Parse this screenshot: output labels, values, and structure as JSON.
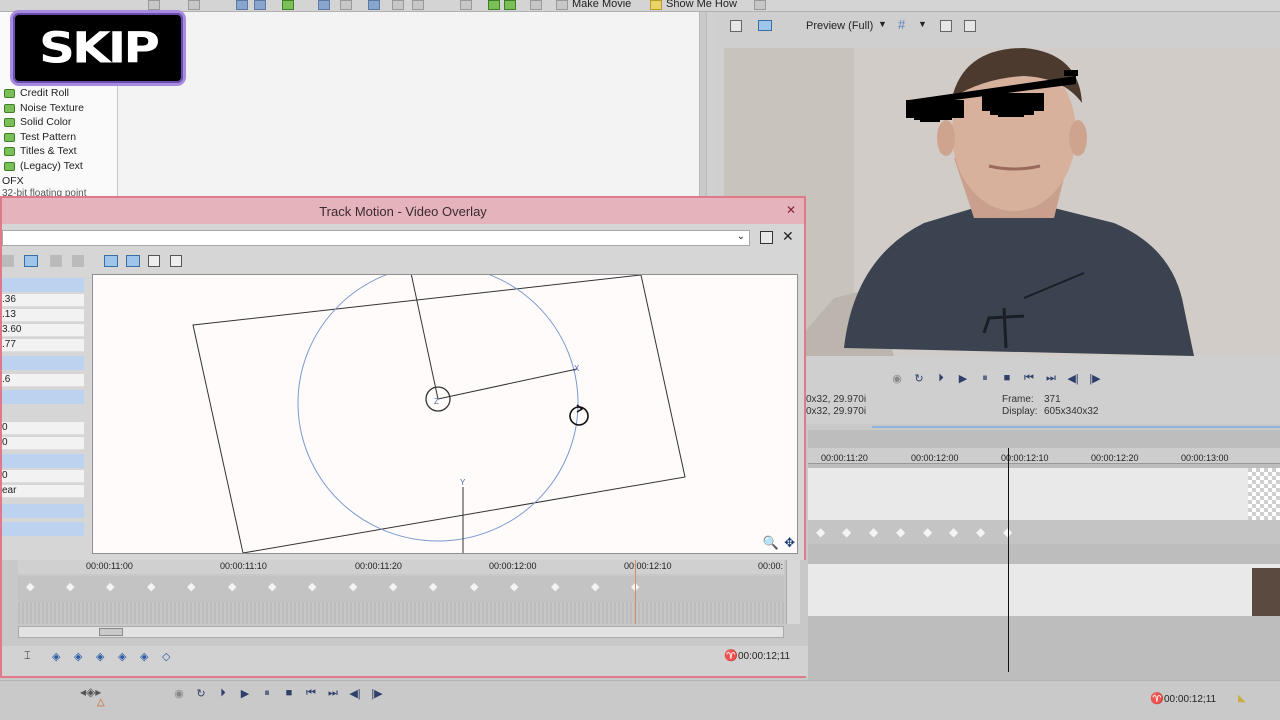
{
  "toolbar": {
    "make_movie": "Make Movie",
    "show_me_how": "Show Me How"
  },
  "badge": {
    "text": "SKIP"
  },
  "media_tree": {
    "items": [
      {
        "label": "Credit Roll"
      },
      {
        "label": "Noise Texture"
      },
      {
        "label": "Solid Color"
      },
      {
        "label": "Test Pattern"
      },
      {
        "label": "Titles & Text"
      },
      {
        "label": "(Legacy) Text"
      }
    ],
    "ofx": "OFX",
    "float": "32-bit floating point"
  },
  "preview": {
    "mode": "Preview (Full)",
    "info_left_1": "0x32, 29.970i",
    "info_left_2": "0x32, 29.970i",
    "frame_label": "Frame:",
    "frame_value": "371",
    "display_label": "Display:",
    "display_value": "605x340x32"
  },
  "timeline_right": {
    "ticks": [
      "00:00:11:20",
      "00:00:12:00",
      "00:00:12:10",
      "00:00:12:20",
      "00:00:13:00"
    ]
  },
  "dialog": {
    "title": "Track Motion - Video Overlay",
    "props": [
      ".36",
      ".13",
      "3.60",
      ".77",
      ".6",
      "0",
      "0",
      "0",
      "ear"
    ],
    "timeline_ticks": [
      "00:00:11:00",
      "00:00:11:10",
      "00:00:11:20",
      "00:00:12:00",
      "00:00:12:10",
      "00:00:"
    ],
    "timecode": "00:00:12;11",
    "canvas_labels": {
      "z": "Z",
      "x": "X",
      "y": "Y"
    }
  },
  "bottom": {
    "timecode": "00:00:12;11"
  }
}
